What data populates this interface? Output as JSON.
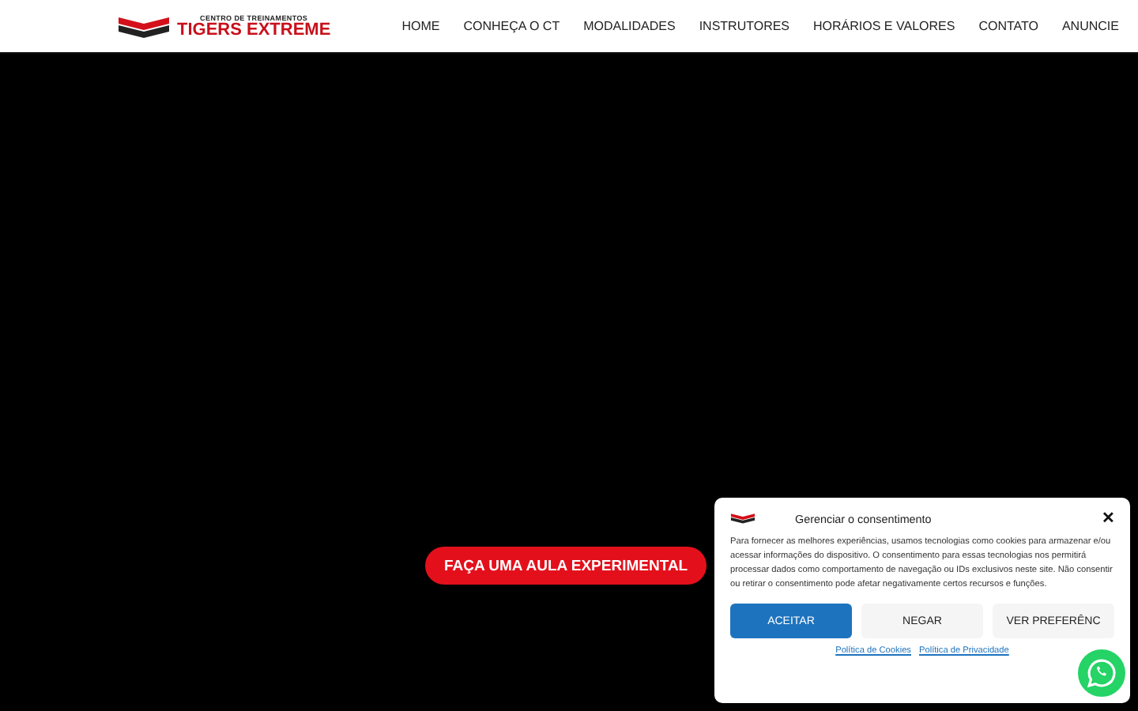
{
  "logo": {
    "tagline": "CENTRO DE TREINAMENTOS",
    "name": "TIGERS EXTREME"
  },
  "nav": [
    {
      "label": "HOME"
    },
    {
      "label": "CONHEÇA O CT"
    },
    {
      "label": "MODALIDADES"
    },
    {
      "label": "INSTRUTORES"
    },
    {
      "label": "HORÁRIOS E VALORES"
    },
    {
      "label": "CONTATO"
    },
    {
      "label": "ANUNCIE"
    }
  ],
  "hero": {
    "cta": "FAÇA UMA AULA EXPERIMENTAL"
  },
  "consent": {
    "title": "Gerenciar o consentimento",
    "close": "✕",
    "text": "Para fornecer as melhores experiências, usamos tecnologias como cookies para armazenar e/ou acessar informações do dispositivo. O consentimento para essas tecnologias nos permitirá processar dados como comportamento de navegação ou IDs exclusivos neste site. Não consentir ou retirar o consentimento pode afetar negativamente certos recursos e funções.",
    "buttons": [
      {
        "label": "ACEITAR",
        "kind": "primary"
      },
      {
        "label": "NEGAR",
        "kind": "plain"
      },
      {
        "label": "VER PREFERÊNC",
        "kind": "plain"
      }
    ],
    "links": [
      {
        "label": "Política de Cookies"
      },
      {
        "label": "Política de Privacidade"
      }
    ]
  }
}
